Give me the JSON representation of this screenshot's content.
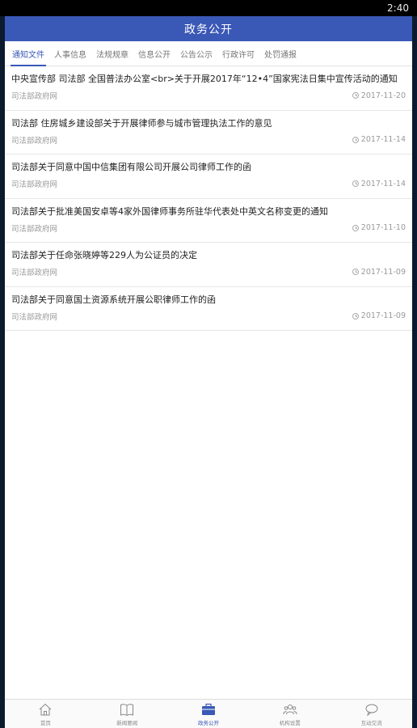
{
  "status_bar": {
    "time": "2:40"
  },
  "header": {
    "title": "政务公开"
  },
  "tabs": [
    {
      "label": "通知文件",
      "active": true
    },
    {
      "label": "人事信息",
      "active": false
    },
    {
      "label": "法规规章",
      "active": false
    },
    {
      "label": "信息公开",
      "active": false
    },
    {
      "label": "公告公示",
      "active": false
    },
    {
      "label": "行政许可",
      "active": false
    },
    {
      "label": "处罚通报",
      "active": false
    }
  ],
  "items": [
    {
      "title": "中央宣传部 司法部 全国普法办公室<br>关于开展2017年“12•4”国家宪法日集中宣传活动的通知",
      "source": "司法部政府网",
      "date": "2017-11-20"
    },
    {
      "title": "司法部 住房城乡建设部关于开展律师参与城市管理执法工作的意见",
      "source": "司法部政府网",
      "date": "2017-11-14"
    },
    {
      "title": "司法部关于同意中国中信集团有限公司开展公司律师工作的函",
      "source": "司法部政府网",
      "date": "2017-11-14"
    },
    {
      "title": "司法部关于批准美国安卓等4家外国律师事务所驻华代表处中英文名称变更的通知",
      "source": "司法部政府网",
      "date": "2017-11-10"
    },
    {
      "title": "司法部关于任命张晓婷等229人为公证员的决定",
      "source": "司法部政府网",
      "date": "2017-11-09"
    },
    {
      "title": "司法部关于同意国土资源系统开展公职律师工作的函",
      "source": "司法部政府网",
      "date": "2017-11-09"
    }
  ],
  "bottom_nav": [
    {
      "label": "首页",
      "icon": "home-icon",
      "active": false
    },
    {
      "label": "新闻要闻",
      "icon": "book-icon",
      "active": false
    },
    {
      "label": "政务公开",
      "icon": "briefcase-icon",
      "active": true
    },
    {
      "label": "机构设置",
      "icon": "people-icon",
      "active": false
    },
    {
      "label": "互动交流",
      "icon": "chat-icon",
      "active": false
    }
  ],
  "colors": {
    "accent": "#3a58b5",
    "header_bg": "#3a58b5"
  }
}
